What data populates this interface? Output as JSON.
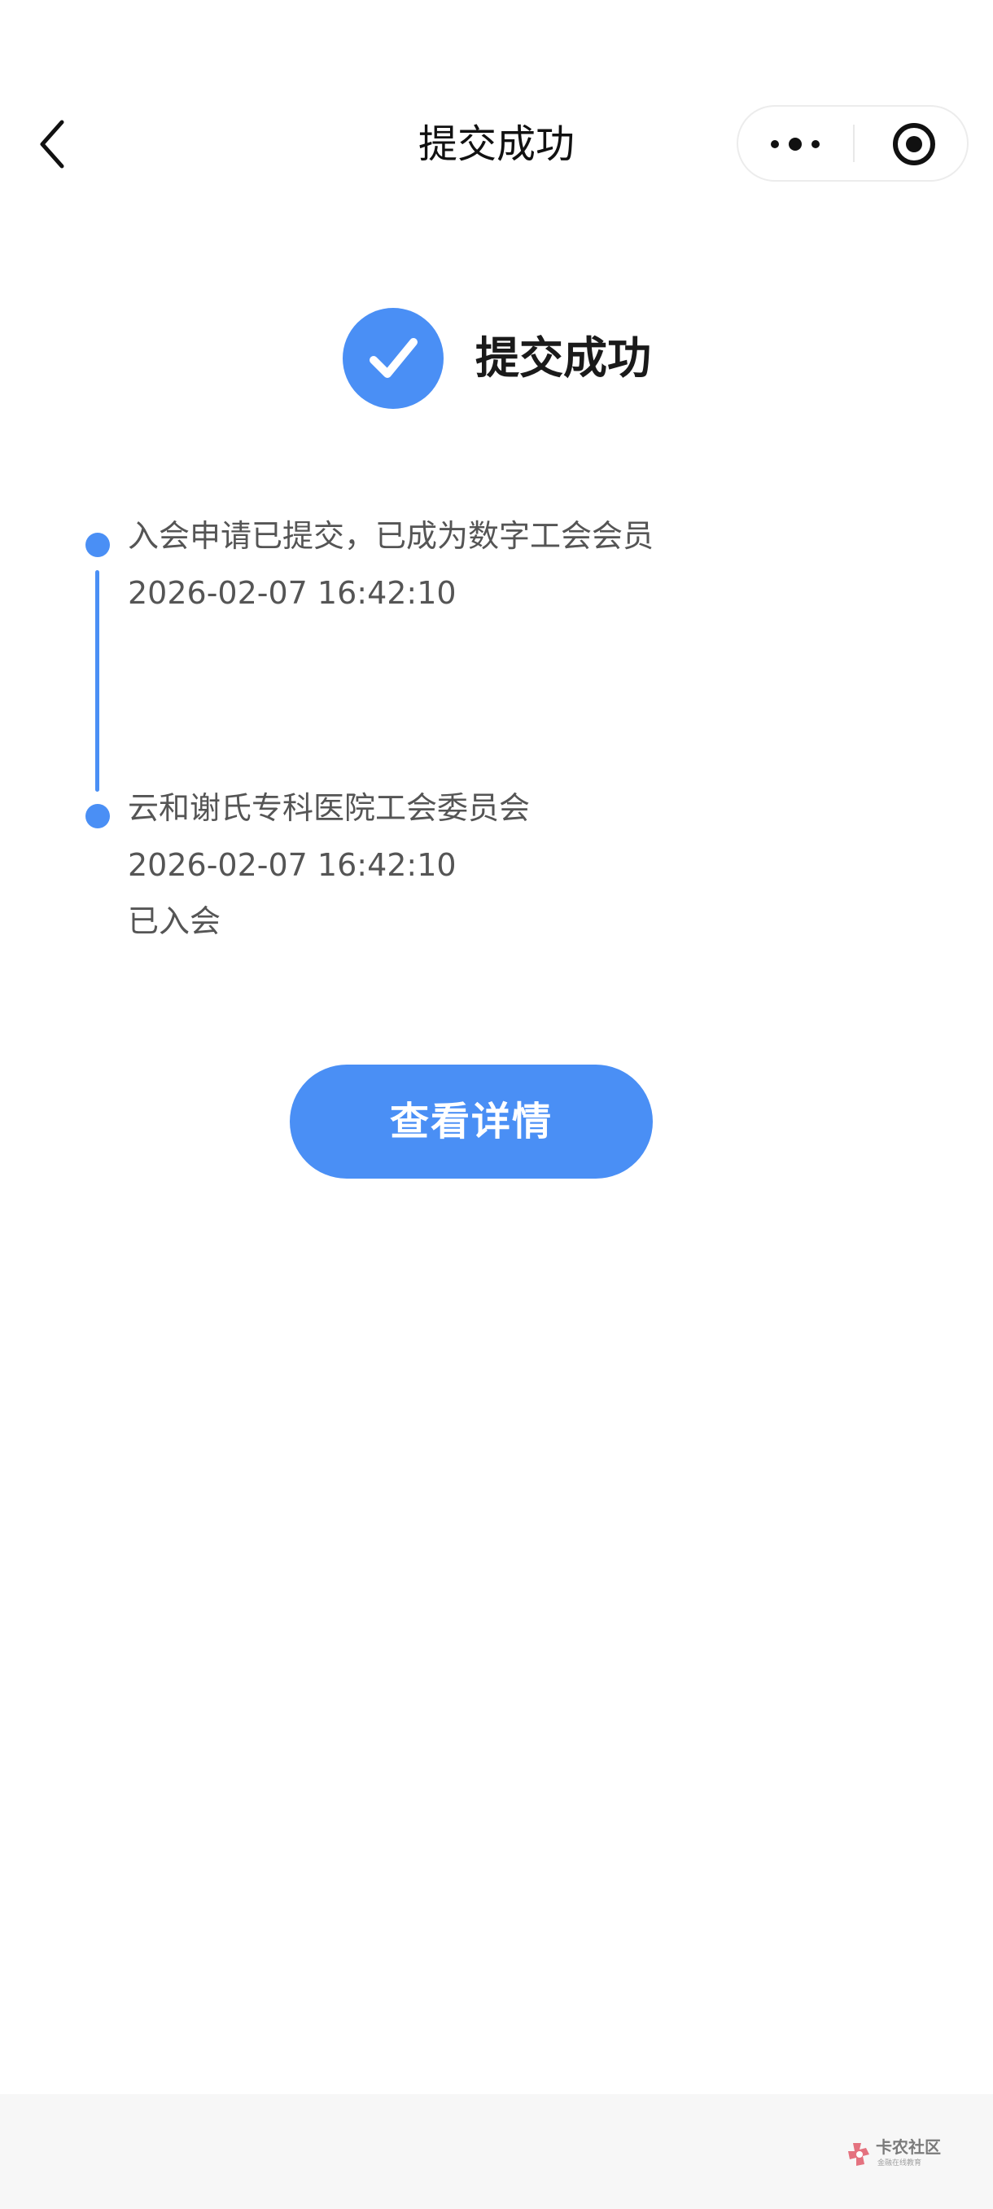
{
  "nav": {
    "title": "提交成功"
  },
  "success": {
    "title": "提交成功"
  },
  "timeline": {
    "items": [
      {
        "text": "入会申请已提交，已成为数字工会会员",
        "time": "2026-02-07 16:42:10"
      },
      {
        "text": "云和谢氏专科医院工会委员会",
        "time": "2026-02-07 16:42:10",
        "status": "已入会"
      }
    ]
  },
  "actions": {
    "detail_label": "查看详情"
  },
  "watermark": {
    "title": "卡农社区",
    "subtitle": "金融在线教育"
  },
  "colors": {
    "accent": "#4a8ff5",
    "title": "#111111",
    "body_text": "#555555",
    "footer_bg": "#f7f7f7"
  },
  "icons": {
    "back": "chevron-left-icon",
    "more": "more-dots-icon",
    "close": "target-circle-icon",
    "success": "check-circle-icon"
  }
}
